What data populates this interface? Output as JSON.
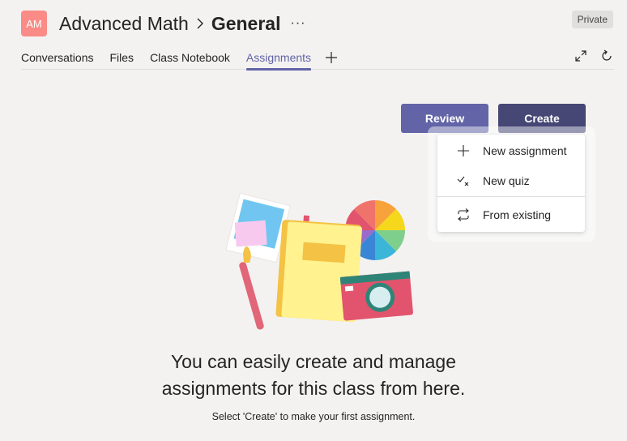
{
  "header": {
    "avatar_initials": "AM",
    "class_name": "Advanced Math",
    "channel_name": "General",
    "more_glyph": "···",
    "privacy_badge": "Private"
  },
  "tabs": [
    {
      "label": "Conversations",
      "active": false
    },
    {
      "label": "Files",
      "active": false
    },
    {
      "label": "Class Notebook",
      "active": false
    },
    {
      "label": "Assignments",
      "active": true
    }
  ],
  "toolbar": {
    "review_label": "Review",
    "create_label": "Create"
  },
  "create_menu": {
    "items": [
      {
        "label": "New assignment",
        "icon": "plus-icon"
      },
      {
        "label": "New quiz",
        "icon": "quiz-check-icon"
      },
      {
        "label": "From existing",
        "icon": "reuse-arrows-icon"
      }
    ]
  },
  "empty_state": {
    "heading_line1": "You can easily create and manage",
    "heading_line2": "assignments for this class from here.",
    "subtext": "Select 'Create' to make your first assignment."
  },
  "colors": {
    "accent": "#6264a7",
    "create_button": "#464775",
    "avatar": "#fa8b86",
    "background": "#f3f2f1"
  }
}
